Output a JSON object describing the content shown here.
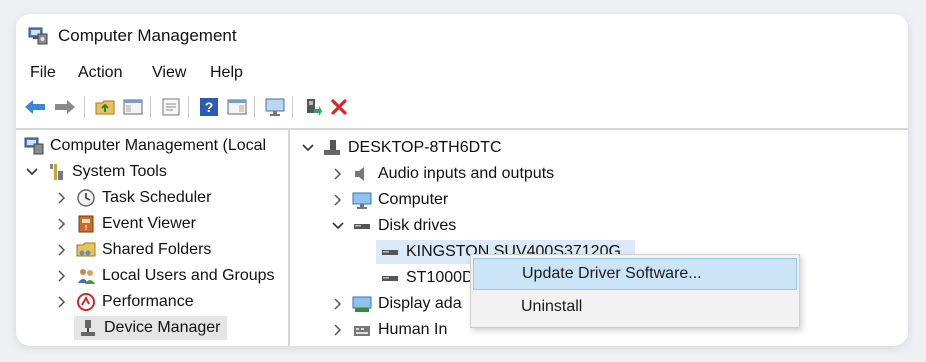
{
  "window": {
    "title": "Computer Management"
  },
  "menu": [
    "File",
    "Action",
    "View",
    "Help"
  ],
  "toolbar": {
    "icons": [
      "back-arrow-icon",
      "forward-arrow-icon",
      "up-folder-icon",
      "show-hide-tree-icon",
      "properties-icon",
      "help-icon",
      "show-action-pane-icon",
      "monitor-icon",
      "enable-device-icon",
      "uninstall-x-icon"
    ]
  },
  "left_tree": {
    "root": "Computer Management (Local",
    "system_tools": "System Tools",
    "items": [
      "Task Scheduler",
      "Event Viewer",
      "Shared Folders",
      "Local Users and Groups",
      "Performance",
      "Device Manager"
    ]
  },
  "device_tree": {
    "computer": "DESKTOP-8TH6DTC",
    "audio": "Audio inputs and outputs",
    "computer_cat": "Computer",
    "disk_drives": "Disk drives",
    "disk1": "KINGSTON SUV400S37120G",
    "disk2": "ST1000D",
    "display": "Display ada",
    "human": "Human In"
  },
  "context_menu": {
    "update": "Update Driver Software...",
    "uninstall": "Uninstall"
  },
  "colors": {
    "selection": "#cce4f7",
    "delete_red": "#d9262a"
  }
}
